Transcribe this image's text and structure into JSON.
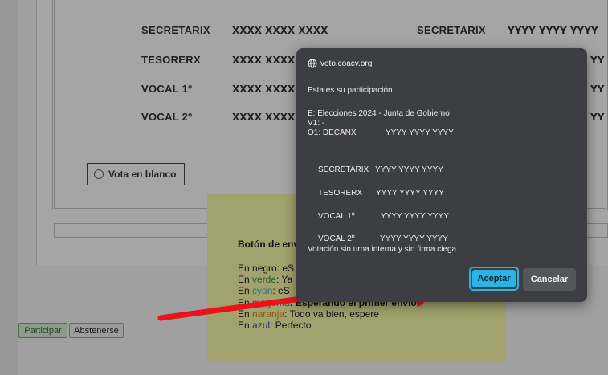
{
  "ballot": {
    "rows": [
      {
        "label": "SECRETARIX",
        "name1": "XXXX XXXX XXXX",
        "label2": "SECRETARIX",
        "name2": "YYYY YYYY YYYY"
      },
      {
        "label": "TESORERX",
        "name1": "XXXX XXXX",
        "name2": "YY"
      },
      {
        "label": "VOCAL 1º",
        "name1": "XXXX XXXX",
        "name2": "YY"
      },
      {
        "label": "VOCAL 2º",
        "name1": "XXXX XXXX",
        "name2": "YY"
      }
    ],
    "blank_vote_label": "Vota en blanco"
  },
  "legend": {
    "title": "Botón de env",
    "lines": [
      {
        "prefix": "En ",
        "color_word": "negro",
        "rest": ": eS"
      },
      {
        "prefix": "En ",
        "color_word": "verde",
        "rest": ": Ya"
      },
      {
        "prefix": "En ",
        "color_word": "cyan",
        "rest": ": eS"
      },
      {
        "prefix": "En ",
        "color_word": "magenta",
        "rest": ": Esperando el primer envío"
      },
      {
        "prefix": "En ",
        "color_word": "naranja",
        "rest": ": Todo va bien, espere"
      },
      {
        "prefix": "En ",
        "color_word": "azul",
        "rest": ": Perfecto"
      }
    ]
  },
  "actions": {
    "participate": "Participar",
    "abstain": "Abstenerse"
  },
  "dialog": {
    "origin": "voto.coacv.org",
    "heading": "Esta es su participación",
    "election": "E: Elecciones 2024 - Junta de Gobierno",
    "v1": "V1: -",
    "o1_label": "O1: DECANX",
    "o1_value": "YYYY YYYY YYYY",
    "entries": [
      {
        "role": "SECRETARIX",
        "value": "YYYY YYYY YYYY"
      },
      {
        "role": "TESORERX",
        "value": "YYYY YYYY YYYY"
      },
      {
        "role": "VOCAL 1º",
        "value": "YYYY YYYY YYYY"
      },
      {
        "role": "VOCAL 2º",
        "value": "YYYY YYYY YYYY"
      }
    ],
    "footer_note": "Votación sin urna interna y sin firma ciega",
    "accept": "Aceptar",
    "cancel": "Cancelar"
  },
  "colors": {
    "dialog_bg": "#3d3e44",
    "accept_bg": "#2ab4e6",
    "arrow": "#e8141a",
    "legend_bg": "#fafaa0"
  },
  "icons": {
    "origin": "globe-icon",
    "radio": "radio-icon",
    "annotation": "red-arrow-icon"
  }
}
